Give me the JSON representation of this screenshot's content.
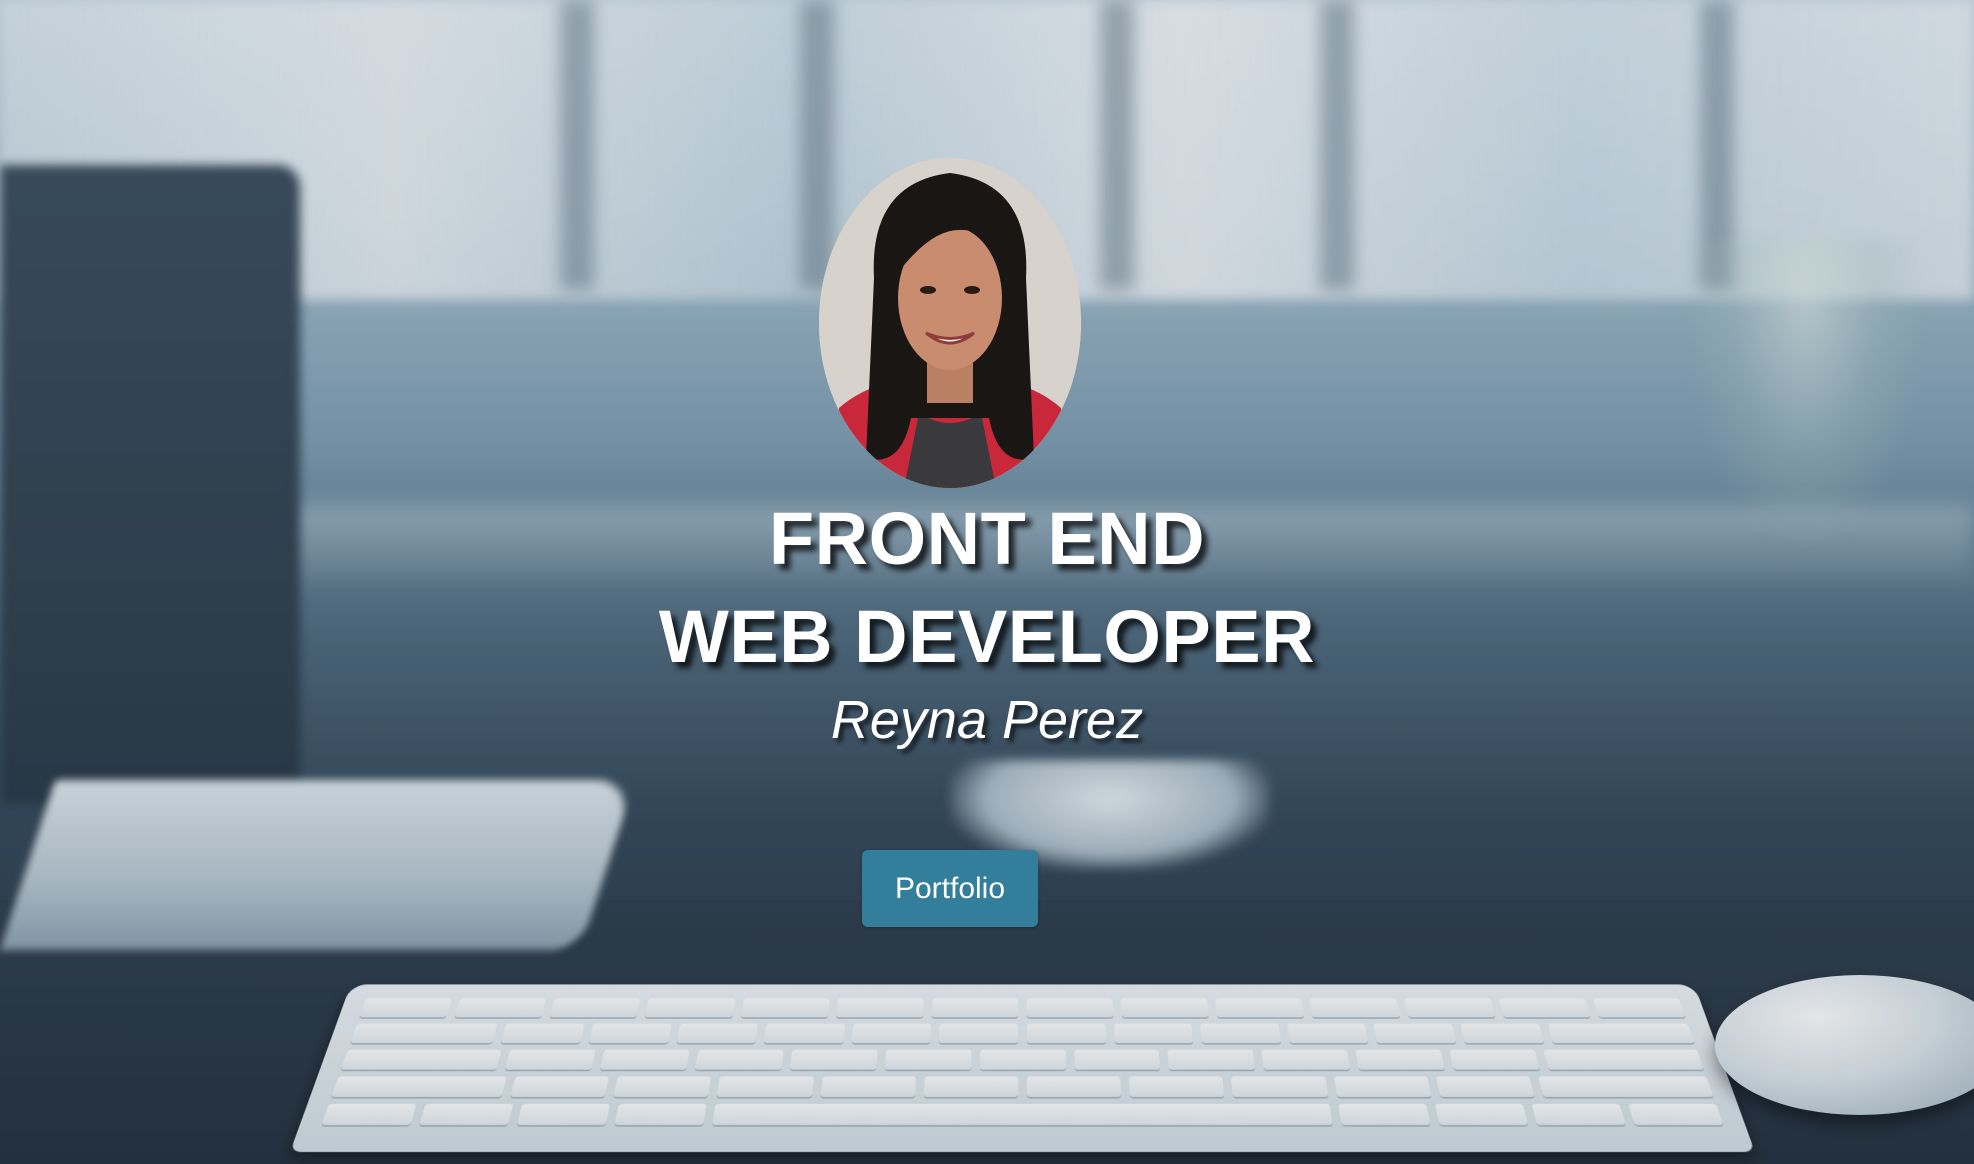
{
  "hero": {
    "title_line1": "FRONT END",
    "title_line2": "WEB DEVELOPER",
    "name": "Reyna Perez",
    "button_label": "Portfolio",
    "button_color": "#337e9a",
    "text_color": "#ffffff"
  }
}
